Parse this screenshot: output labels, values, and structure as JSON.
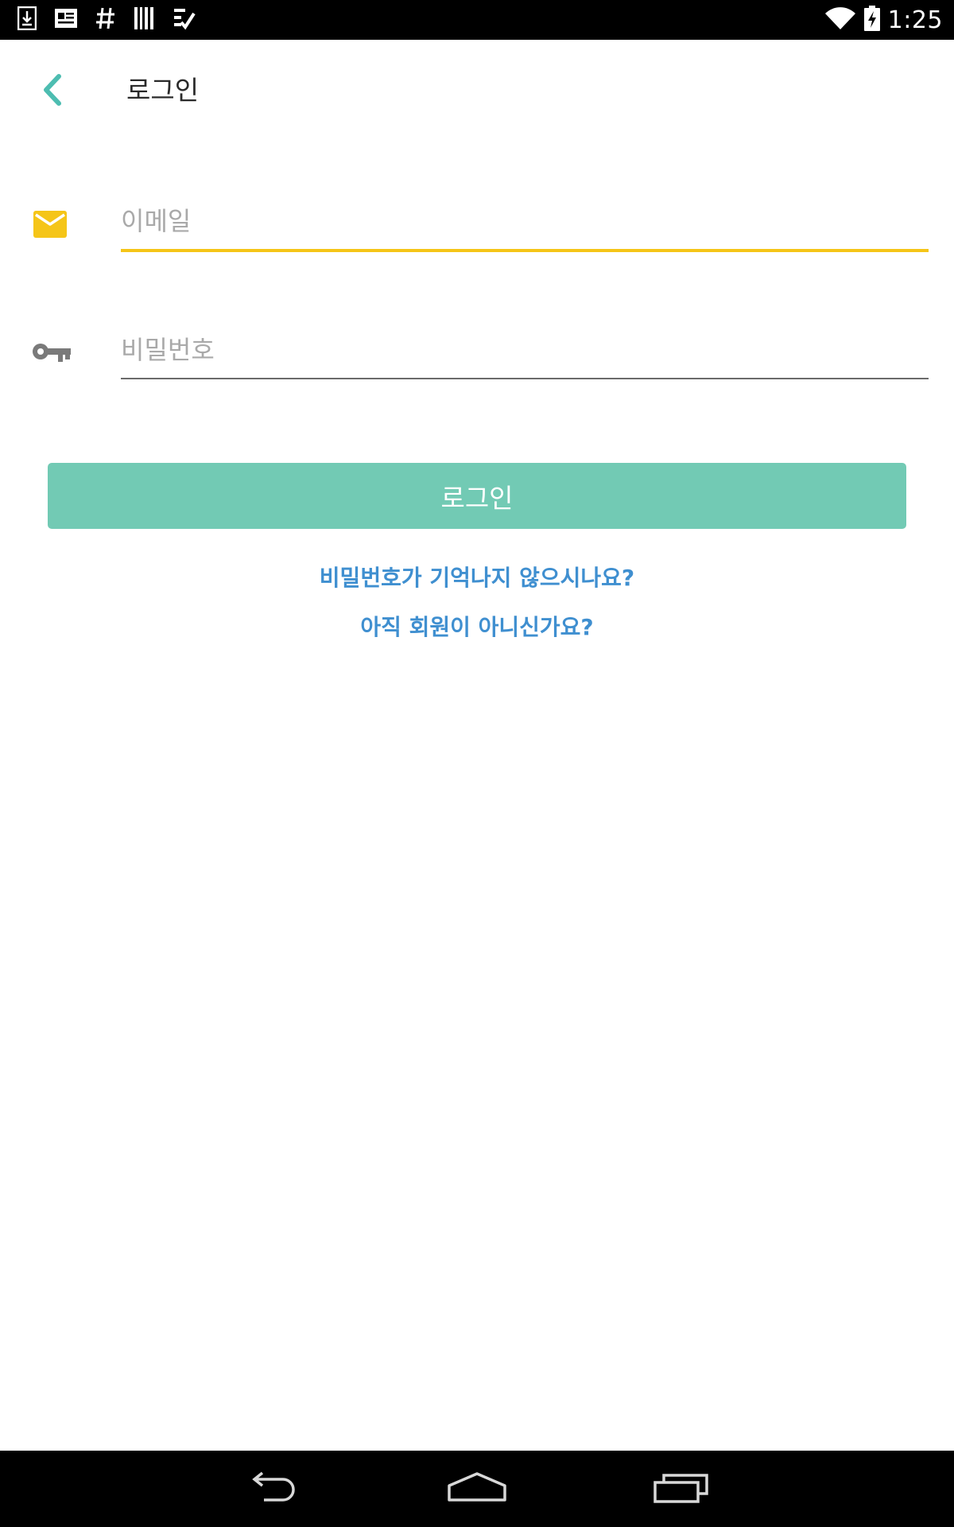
{
  "status_bar": {
    "time": "1:25",
    "left_icons": [
      "download-icon",
      "news-icon",
      "hashtag-icon",
      "barcode-icon",
      "checklist-icon"
    ],
    "right_icons": [
      "wifi-icon",
      "battery-charging-icon"
    ]
  },
  "header": {
    "title": "로그인",
    "back_icon": "chevron-left-icon"
  },
  "form": {
    "email": {
      "placeholder": "이메일",
      "value": "",
      "icon": "mail-icon"
    },
    "password": {
      "placeholder": "비밀번호",
      "value": "",
      "icon": "key-icon"
    },
    "submit_label": "로그인"
  },
  "links": {
    "forgot_password": "비밀번호가 기억나지 않으시나요?",
    "sign_up": "아직 회원이 아니신가요?"
  },
  "nav_bar": {
    "icons": [
      "back-icon",
      "home-icon",
      "recents-icon"
    ]
  },
  "colors": {
    "accent_teal": "#72cab4",
    "back_teal": "#4dbdb1",
    "focus_yellow": "#f5c518",
    "link_blue": "#3f8fd0",
    "icon_gray": "#7a7a7a"
  }
}
